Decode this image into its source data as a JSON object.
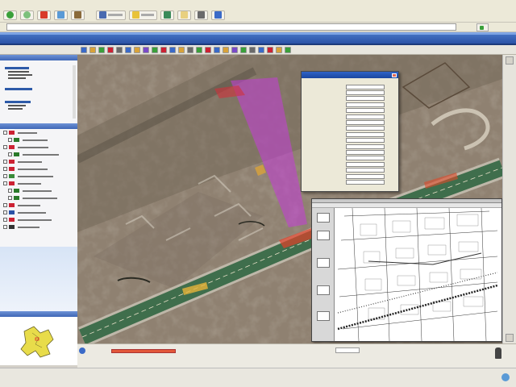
{
  "colors": {
    "header_blue": "#2a52a6",
    "panel_title_blue": "#3f67b6",
    "highlight_magenta": "#c43cd8",
    "scale_red": "#e2573a",
    "road_green": "#3f6e4c"
  },
  "browser": {
    "menu": [
      "",
      "",
      "",
      "",
      "",
      ""
    ],
    "nav_icons": [
      "back-icon",
      "forward-icon",
      "stop-icon",
      "refresh-icon",
      "home-icon",
      "search-icon",
      "favorites-icon",
      "history-icon",
      "mail-icon",
      "print-icon"
    ],
    "address_value": "",
    "go_label": "",
    "links_label": ""
  },
  "sidebar": {
    "panel1_title": "",
    "panel1_subtitle": "",
    "layers_title": "",
    "overview_title": "",
    "layers": [
      {
        "label": "",
        "color": "#c23"
      },
      {
        "label": "",
        "color": "#2a7a2a"
      },
      {
        "label": "",
        "color": "#c23"
      },
      {
        "label": "",
        "color": "#2a7a2a"
      },
      {
        "label": "",
        "color": "#c23"
      },
      {
        "label": "",
        "color": "#c23"
      },
      {
        "label": "",
        "color": "#3a8a3a"
      },
      {
        "label": "",
        "color": "#c23"
      },
      {
        "label": "",
        "color": "#2a7a2a"
      },
      {
        "label": "",
        "color": "#2a7a2a"
      },
      {
        "label": "",
        "color": "#c23"
      },
      {
        "label": "",
        "color": "#2a52a6"
      },
      {
        "label": "",
        "color": "#c23"
      },
      {
        "label": "",
        "color": "#333"
      }
    ]
  },
  "properties_dialog": {
    "title": "",
    "header": "",
    "rows": [
      {
        "key": "",
        "value": ""
      },
      {
        "key": "",
        "value": ""
      },
      {
        "key": "",
        "value": ""
      },
      {
        "key": "",
        "value": ""
      },
      {
        "key": "",
        "value": ""
      },
      {
        "key": "",
        "value": ""
      },
      {
        "key": "",
        "value": ""
      },
      {
        "key": "",
        "value": ""
      },
      {
        "key": "",
        "value": ""
      },
      {
        "key": "",
        "value": ""
      },
      {
        "key": "",
        "value": ""
      },
      {
        "key": "",
        "value": ""
      },
      {
        "key": "",
        "value": ""
      },
      {
        "key": "",
        "value": ""
      },
      {
        "key": "",
        "value": ""
      },
      {
        "key": "",
        "value": ""
      },
      {
        "key": "",
        "value": ""
      }
    ]
  },
  "status": {
    "logo_text": "",
    "status_text": "",
    "scale_label": ""
  }
}
